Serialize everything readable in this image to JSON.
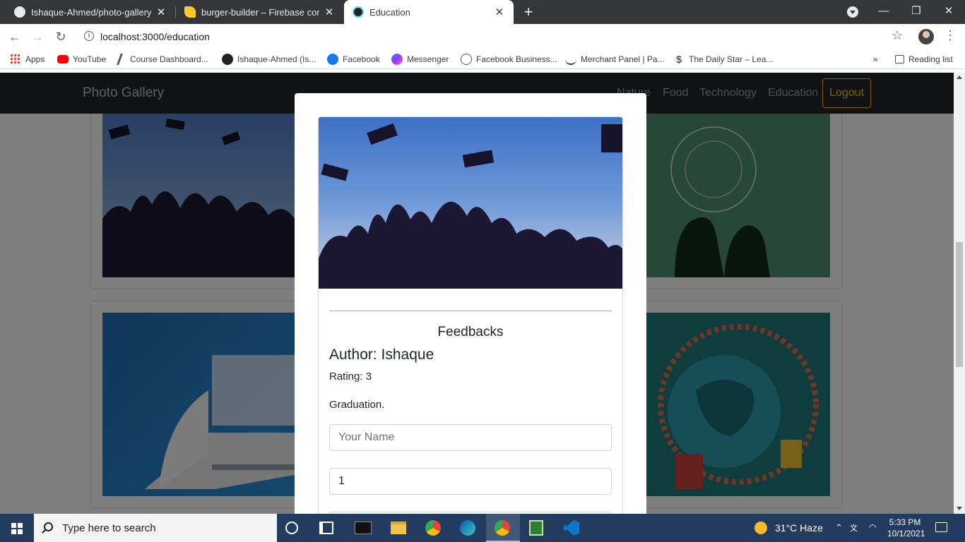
{
  "browser": {
    "tabs": [
      {
        "title": "Ishaque-Ahmed/photo-gallery",
        "active": false
      },
      {
        "title": "burger-builder – Firebase console",
        "active": false
      },
      {
        "title": "Education",
        "active": true
      }
    ],
    "new_tab": "+",
    "url": "localhost:3000/education",
    "bookmarks": [
      "Apps",
      "YouTube",
      "Course Dashboard...",
      "Ishaque-Ahmed (Is...",
      "Facebook",
      "Messenger",
      "Facebook Business...",
      "Merchant Panel | Pa...",
      "The Daily Star – Lea..."
    ],
    "bookmarks_overflow": "»",
    "reading_list": "Reading list"
  },
  "app": {
    "brand": "Photo Gallery",
    "nav": [
      "Nature",
      "Food",
      "Technology",
      "Education"
    ],
    "logout": "Logout"
  },
  "modal": {
    "feedbacks_title": "Feedbacks",
    "author": "Author: Ishaque",
    "rating": "Rating: 3",
    "comment": "Graduation.",
    "name_placeholder": "Your Name",
    "rating_value": "1"
  },
  "taskbar": {
    "search_placeholder": "Type here to search",
    "weather": "31°C  Haze",
    "time": "5:33 PM",
    "date": "10/1/2021"
  },
  "colors": {
    "navbar": "#212529",
    "logout_accent": "#ffc107"
  }
}
